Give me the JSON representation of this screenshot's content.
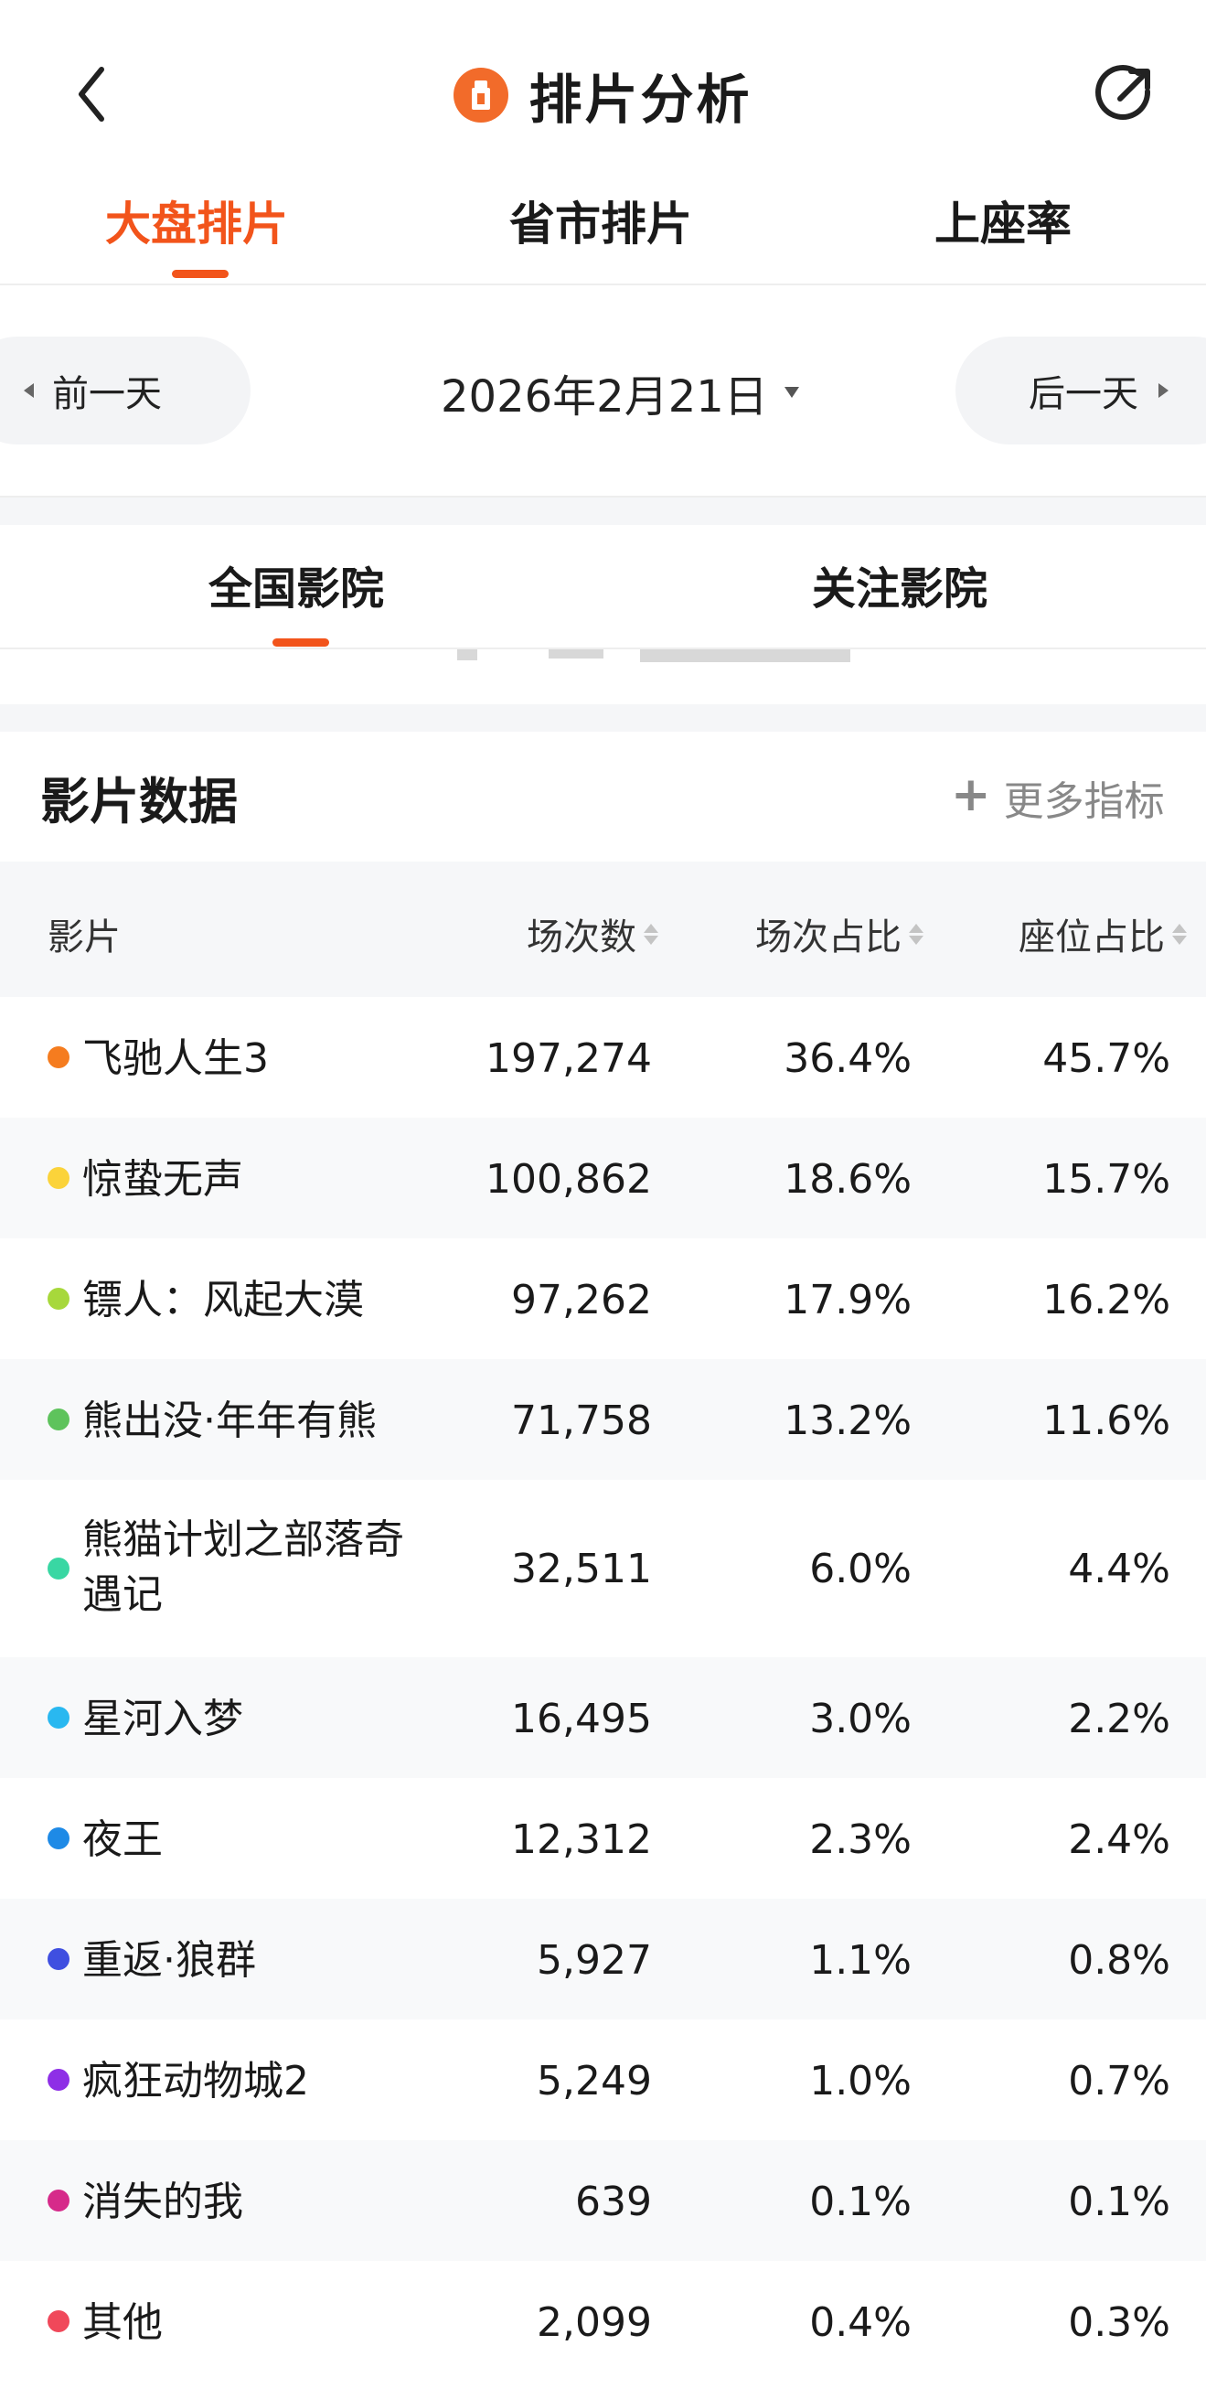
{
  "header": {
    "title": "排片分析"
  },
  "tabs": [
    {
      "label": "大盘排片",
      "active": true
    },
    {
      "label": "省市排片",
      "active": false
    },
    {
      "label": "上座率",
      "active": false
    }
  ],
  "date_nav": {
    "prev": "前一天",
    "date": "2026年2月21日",
    "next": "后一天"
  },
  "subtabs": [
    {
      "label": "全国影院",
      "active": true
    },
    {
      "label": "关注影院",
      "active": false
    }
  ],
  "section": {
    "title": "影片数据",
    "more": "更多指标"
  },
  "table": {
    "columns": [
      "影片",
      "场次数",
      "场次占比",
      "座位占比"
    ],
    "rows": [
      {
        "name": "飞驰人生3",
        "shows": "197,274",
        "show_share": "36.4%",
        "seat_share": "45.7%",
        "color": "#f57c1f"
      },
      {
        "name": "惊蛰无声",
        "shows": "100,862",
        "show_share": "18.6%",
        "seat_share": "15.7%",
        "color": "#fbd33a"
      },
      {
        "name": "镖人：风起大漠",
        "shows": "97,262",
        "show_share": "17.9%",
        "seat_share": "16.2%",
        "color": "#a7d83b"
      },
      {
        "name": "熊出没·年年有熊",
        "shows": "71,758",
        "show_share": "13.2%",
        "seat_share": "11.6%",
        "color": "#5ec35c"
      },
      {
        "name": "熊猫计划之部落奇遇记",
        "shows": "32,511",
        "show_share": "6.0%",
        "seat_share": "4.4%",
        "color": "#39d7a3"
      },
      {
        "name": "星河入梦",
        "shows": "16,495",
        "show_share": "3.0%",
        "seat_share": "2.2%",
        "color": "#29b8f0"
      },
      {
        "name": "夜王",
        "shows": "12,312",
        "show_share": "2.3%",
        "seat_share": "2.4%",
        "color": "#1e8ae6"
      },
      {
        "name": "重返·狼群",
        "shows": "5,927",
        "show_share": "1.1%",
        "seat_share": "0.8%",
        "color": "#3f4fe0"
      },
      {
        "name": "疯狂动物城2",
        "shows": "5,249",
        "show_share": "1.0%",
        "seat_share": "0.7%",
        "color": "#8e2fe6"
      },
      {
        "name": "消失的我",
        "shows": "639",
        "show_share": "0.1%",
        "seat_share": "0.1%",
        "color": "#d62a8a"
      },
      {
        "name": "其他",
        "shows": "2,099",
        "show_share": "0.4%",
        "seat_share": "0.3%",
        "color": "#f0485a"
      }
    ]
  }
}
